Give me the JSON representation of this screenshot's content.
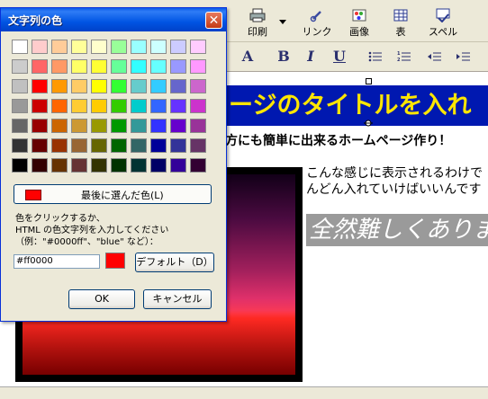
{
  "toolbar": {
    "print_label": "印刷",
    "link_label": "リンク",
    "image_label": "画像",
    "table_label": "表",
    "spell_label": "スペル"
  },
  "format_bar": {
    "font_grow": "A",
    "bold": "B",
    "italic": "I",
    "underline": "U"
  },
  "editor": {
    "title_text": "ージのタイトルを入れ",
    "subtitle_text": "方にも簡単に出来るホームページ作り！",
    "body_line1": "こんな感じに表示されるわけで",
    "body_line2": "んどん入れていけばいいんです",
    "big_text": "全然難しくありま"
  },
  "dialog": {
    "title": "文字列の色",
    "close_label": "✕",
    "last_color_label": "最後に選んだ色(L)",
    "hint_line1": "色をクリックするか、",
    "hint_line2": "HTML の色文字列を入力してください",
    "hint_line3": "（例：\"#0000ff\"、\"blue\" など）：",
    "color_value": "#ff0000",
    "default_label": "デフォルト（D）",
    "ok_label": "OK",
    "cancel_label": "キャンセル"
  },
  "colors": {
    "last_color": "#ff0000",
    "selected_color": "#ff0000",
    "title_banner_bg": "#0018b0",
    "title_banner_text": "#ffe600"
  },
  "palette": [
    [
      "#ffffff",
      "#ffcccc",
      "#ffcc99",
      "#ffff99",
      "#ffffcc",
      "#99ff99",
      "#99ffff",
      "#ccffff",
      "#ccccff",
      "#ffccff"
    ],
    [
      "#cccccc",
      "#ff6666",
      "#ff9966",
      "#ffff66",
      "#ffff33",
      "#66ff99",
      "#33ffff",
      "#66ffff",
      "#9999ff",
      "#ff99ff"
    ],
    [
      "#c0c0c0",
      "#ff0000",
      "#ff9900",
      "#ffcc66",
      "#ffff00",
      "#33ff33",
      "#66cccc",
      "#33ccff",
      "#6666cc",
      "#cc66cc"
    ],
    [
      "#999999",
      "#cc0000",
      "#ff6600",
      "#ffcc33",
      "#ffcc00",
      "#33cc00",
      "#00cccc",
      "#3366ff",
      "#6633ff",
      "#cc33cc"
    ],
    [
      "#666666",
      "#990000",
      "#cc6600",
      "#cc9933",
      "#999900",
      "#009900",
      "#339999",
      "#3333ff",
      "#6600cc",
      "#993399"
    ],
    [
      "#333333",
      "#660000",
      "#993300",
      "#996633",
      "#666600",
      "#006600",
      "#336666",
      "#000099",
      "#333399",
      "#663366"
    ],
    [
      "#000000",
      "#330000",
      "#663300",
      "#663333",
      "#333300",
      "#003300",
      "#003333",
      "#000066",
      "#330099",
      "#330033"
    ]
  ]
}
